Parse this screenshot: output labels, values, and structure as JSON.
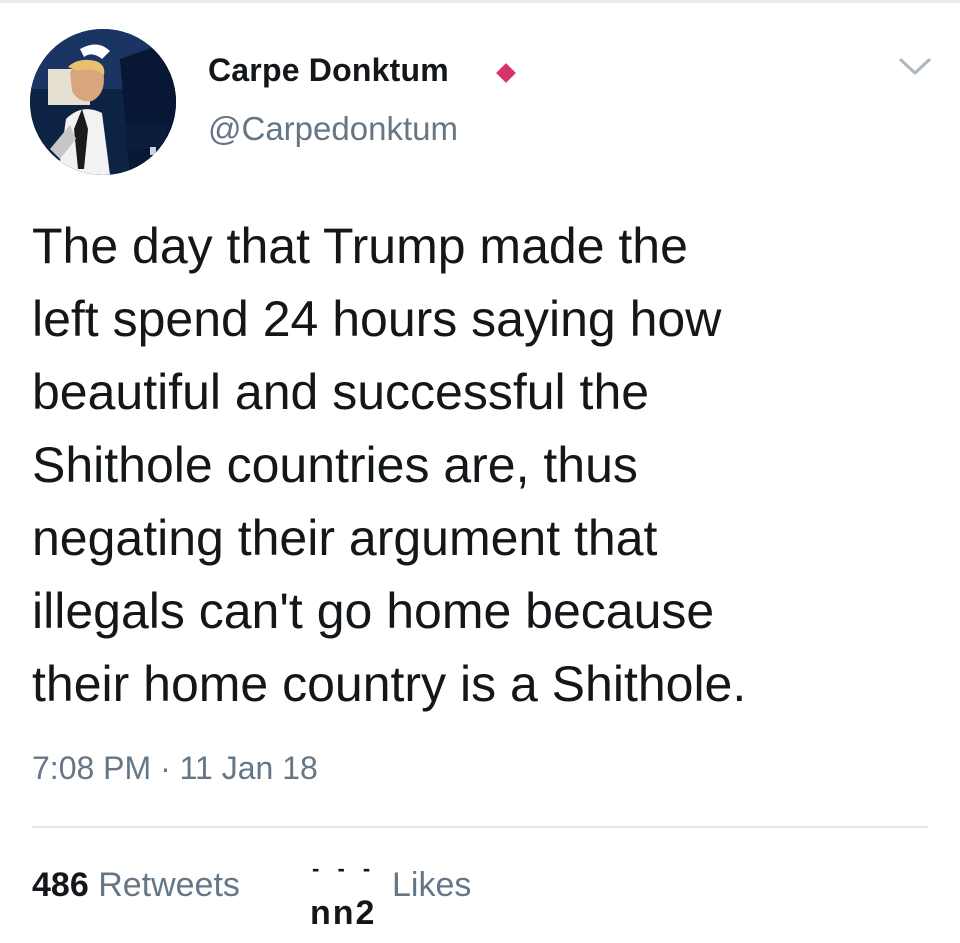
{
  "author": {
    "display_name": "Carpe Donktum",
    "handle": "@Carpedonktum"
  },
  "icons": {
    "verified": "diamond-badge-icon",
    "menu": "chevron-down-icon"
  },
  "colors": {
    "badge": "#d6336c",
    "secondary_text": "#657786",
    "primary_text": "#14171a"
  },
  "tweet": {
    "lines": [
      "The day that Trump made the",
      "left spend 24 hours saying how",
      "beautiful and successful the",
      "Shithole countries are, thus",
      "negating their argument that",
      "illegals can't go home because",
      "their home country is a Shithole."
    ],
    "timestamp": "7:08 PM · 11 Jan 18"
  },
  "stats": {
    "retweets_count": "486",
    "retweets_label": "Retweets",
    "likes_count_visible": "nn2",
    "likes_label": "Likes"
  }
}
